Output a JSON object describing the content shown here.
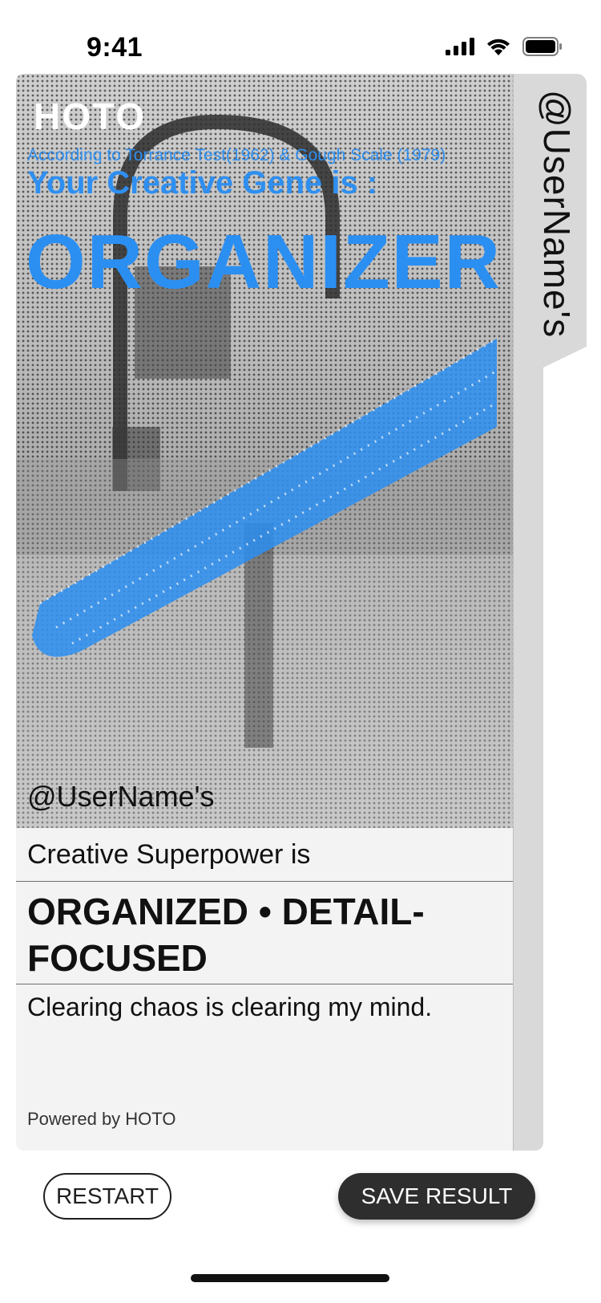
{
  "status_bar": {
    "time": "9:41",
    "icons": [
      "cellular-signal-icon",
      "wifi-icon",
      "battery-icon"
    ]
  },
  "card": {
    "brand": "HOTO",
    "citation": "According to Torrance Test(1962) & Gough Scale (1979)",
    "gene_label": "Your Creative Gene  is :",
    "gene_type": "ORGANIZER",
    "username": "@UserName's",
    "superpower_label": "Creative Superpower is",
    "traits": "ORGANIZED • DETAIL-FOCUSED",
    "quote": "Clearing chaos is clearing my mind.",
    "powered_by": "Powered by HOTO"
  },
  "side_tab": {
    "label": "@UserName's"
  },
  "actions": {
    "restart_label": "RESTART",
    "save_label": "SAVE RESULT"
  },
  "colors": {
    "accent_blue": "#2B8FF2",
    "dark_button": "#2E2E2E",
    "card_bg": "#F3F3F3",
    "tab_bg": "#D9D9D9"
  }
}
